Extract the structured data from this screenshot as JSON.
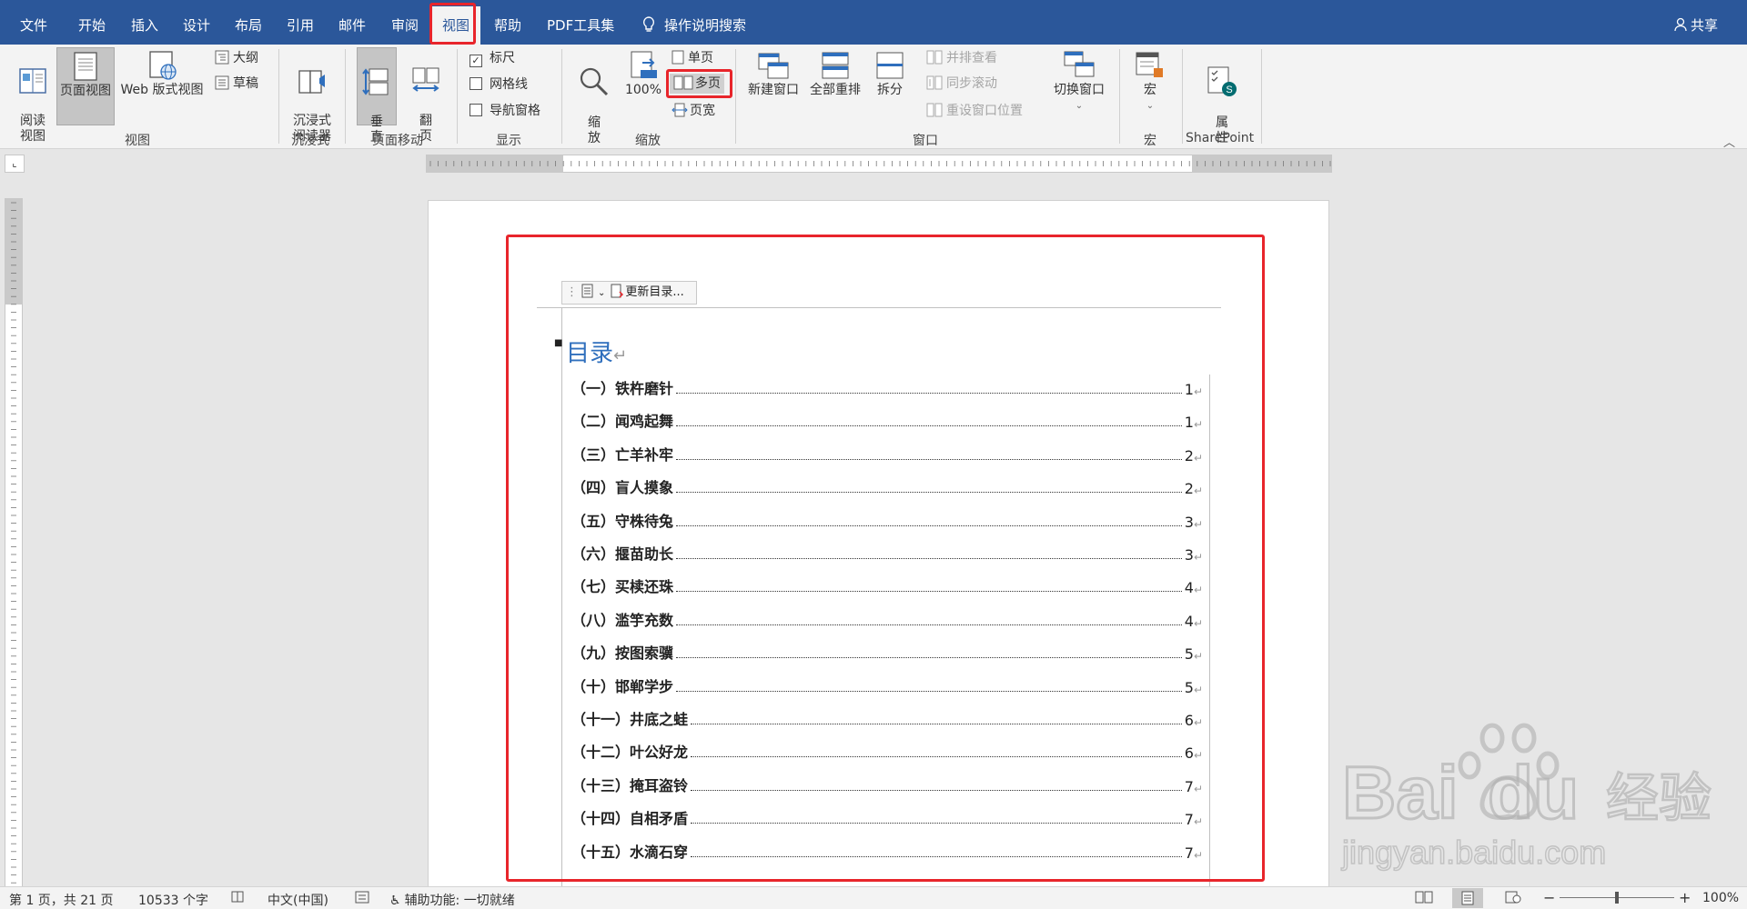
{
  "tabs": {
    "file": "文件",
    "home": "开始",
    "insert": "插入",
    "design": "设计",
    "layout": "布局",
    "references": "引用",
    "mailings": "邮件",
    "review": "审阅",
    "view": "视图",
    "help": "帮助",
    "pdf": "PDF工具集",
    "tell_me": "操作说明搜索",
    "share": "共享"
  },
  "ribbon": {
    "views": {
      "read_mode": "阅读\n视图",
      "print_layout": "页面视图",
      "web_layout": "Web 版式视图",
      "outline": "大纲",
      "draft": "草稿",
      "group": "视图"
    },
    "immersive": {
      "reader": "沉浸式\n阅读器",
      "group": "沉浸式"
    },
    "page_move": {
      "vertical": "垂\n直",
      "flip": "翻\n页",
      "group": "页面移动"
    },
    "show": {
      "ruler": "标尺",
      "gridlines": "网格线",
      "nav_pane": "导航窗格",
      "group": "显示",
      "ruler_checked": true,
      "gridlines_checked": false,
      "nav_pane_checked": false
    },
    "zoom": {
      "zoom": "缩\n放",
      "hundred": "100%",
      "one_page": "单页",
      "multi_page": "多页",
      "page_width": "页宽",
      "group": "缩放"
    },
    "window": {
      "new_window": "新建窗口",
      "arrange_all": "全部重排",
      "split": "拆分",
      "side_by_side": "并排查看",
      "sync_scroll": "同步滚动",
      "reset_pos": "重设窗口位置",
      "switch_windows": "切换窗口",
      "group": "窗口"
    },
    "macros": {
      "macros": "宏",
      "group": "宏"
    },
    "sharepoint": {
      "properties": "属\n性",
      "group": "SharePoint"
    }
  },
  "colors": {
    "title_bar": "#2b579a",
    "highlight": "#e8252b",
    "toc_heading": "#2f6fbd"
  },
  "document": {
    "toc_toolbar_label": "更新目录...",
    "toc_title": "目录",
    "toc_entries": [
      {
        "label": "（一）铁杵磨针",
        "page": "1"
      },
      {
        "label": "（二）闻鸡起舞",
        "page": "1"
      },
      {
        "label": "（三）亡羊补牢",
        "page": "2"
      },
      {
        "label": "（四）盲人摸象",
        "page": "2"
      },
      {
        "label": "（五）守株待兔",
        "page": "3"
      },
      {
        "label": "（六）揠苗助长",
        "page": "3"
      },
      {
        "label": "（七）买椟还珠",
        "page": "4"
      },
      {
        "label": "（八）滥竽充数",
        "page": "4"
      },
      {
        "label": "（九）按图索骥",
        "page": "5"
      },
      {
        "label": "（十）邯郸学步",
        "page": "5"
      },
      {
        "label": "（十一）井底之蛙",
        "page": "6"
      },
      {
        "label": "（十二）叶公好龙",
        "page": "6"
      },
      {
        "label": "（十三）掩耳盗铃",
        "page": "7"
      },
      {
        "label": "（十四）自相矛盾",
        "page": "7"
      },
      {
        "label": "（十五）水滴石穿",
        "page": "7"
      }
    ]
  },
  "status": {
    "page": "第 1 页，共 21 页",
    "words": "10533 个字",
    "language": "中文(中国)",
    "accessibility": "辅助功能: 一切就绪",
    "zoom": "100%",
    "zoom_level": 1.0
  },
  "watermark": {
    "brand": "Bai",
    "brand2": "du",
    "cn": "经验",
    "url": "jingyan.baidu.com"
  }
}
